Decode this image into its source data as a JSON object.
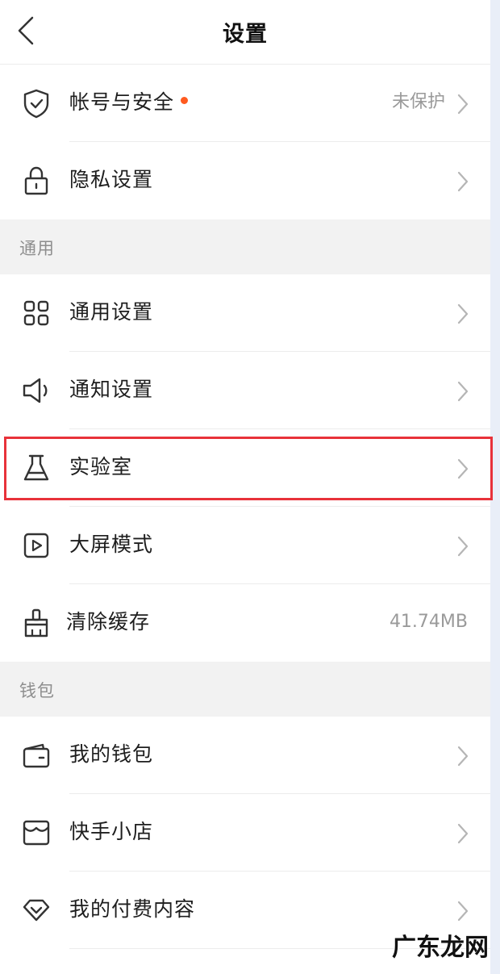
{
  "header": {
    "title": "设置"
  },
  "rows_top": [
    {
      "label": "帐号与安全",
      "value": "未保护",
      "badge_color": "#ff5a1f"
    },
    {
      "label": "隐私设置"
    }
  ],
  "section_general": {
    "title": "通用"
  },
  "rows_general": [
    {
      "label": "通用设置"
    },
    {
      "label": "通知设置"
    },
    {
      "label": "实验室"
    },
    {
      "label": "大屏模式"
    },
    {
      "label": "清除缓存",
      "value": "41.74MB"
    }
  ],
  "section_wallet": {
    "title": "钱包"
  },
  "rows_wallet": [
    {
      "label": "我的钱包"
    },
    {
      "label": "快手小店"
    },
    {
      "label": "我的付费内容"
    }
  ],
  "watermark": {
    "text": "广东龙网"
  },
  "colors": {
    "highlight": "#e8323a",
    "badge": "#ff5a1f",
    "section_bg": "#f2f2f2"
  },
  "icons": [
    "back-arrow-icon",
    "shield-check-icon",
    "lock-icon",
    "grid-icon",
    "speaker-icon",
    "flask-icon",
    "play-screen-icon",
    "broom-icon",
    "wallet-icon",
    "store-icon",
    "diamond-icon",
    "chevron-right-icon"
  ]
}
